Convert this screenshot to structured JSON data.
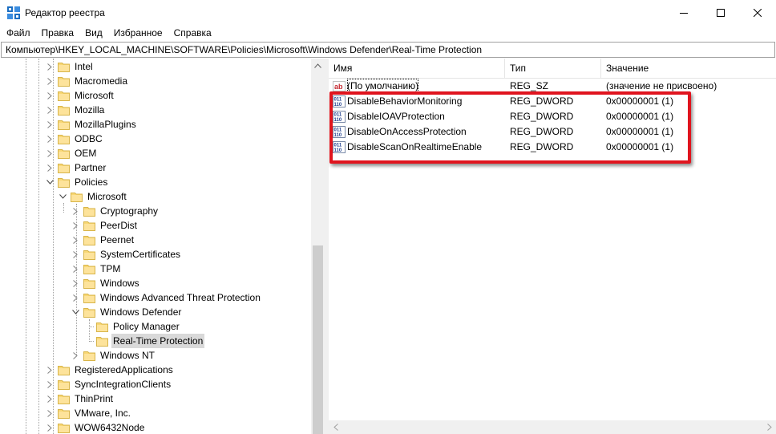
{
  "window": {
    "title": "Редактор реестра",
    "minimize_icon": "minimize-icon",
    "maximize_icon": "maximize-icon",
    "close_icon": "close-icon"
  },
  "menu": [
    "Файл",
    "Правка",
    "Вид",
    "Избранное",
    "Справка"
  ],
  "address": "Компьютер\\HKEY_LOCAL_MACHINE\\SOFTWARE\\Policies\\Microsoft\\Windows Defender\\Real-Time Protection",
  "tree": [
    {
      "label": "Intel",
      "expanded": false
    },
    {
      "label": "Macromedia",
      "expanded": false
    },
    {
      "label": "Microsoft",
      "expanded": false
    },
    {
      "label": "Mozilla",
      "expanded": false
    },
    {
      "label": "MozillaPlugins",
      "expanded": false
    },
    {
      "label": "ODBC",
      "expanded": false
    },
    {
      "label": "OEM",
      "expanded": false
    },
    {
      "label": "Partner",
      "expanded": false
    },
    {
      "label": "Policies",
      "expanded": true
    },
    {
      "label": "Microsoft",
      "expanded": true
    },
    {
      "label": "Cryptography",
      "expanded": false
    },
    {
      "label": "PeerDist",
      "expanded": false
    },
    {
      "label": "Peernet",
      "expanded": false
    },
    {
      "label": "SystemCertificates",
      "expanded": false
    },
    {
      "label": "TPM",
      "expanded": false
    },
    {
      "label": "Windows",
      "expanded": false
    },
    {
      "label": "Windows Advanced Threat Protection",
      "expanded": false
    },
    {
      "label": "Windows Defender",
      "expanded": true
    },
    {
      "label": "Policy Manager",
      "expanded": false
    },
    {
      "label": "Real-Time Protection",
      "expanded": false,
      "selected": true
    },
    {
      "label": "Windows NT",
      "expanded": false
    },
    {
      "label": "RegisteredApplications",
      "expanded": false
    },
    {
      "label": "SyncIntegrationClients",
      "expanded": false
    },
    {
      "label": "ThinPrint",
      "expanded": false
    },
    {
      "label": "VMware, Inc.",
      "expanded": false
    },
    {
      "label": "WOW6432Node",
      "expanded": false
    }
  ],
  "columns": {
    "name": "Имя",
    "type": "Тип",
    "value": "Значение"
  },
  "values": [
    {
      "name": "(По умолчанию)",
      "type": "REG_SZ",
      "data": "(значение не присвоено)",
      "icon": "string-value-icon"
    },
    {
      "name": "DisableBehaviorMonitoring",
      "type": "REG_DWORD",
      "data": "0x00000001 (1)",
      "icon": "dword-value-icon"
    },
    {
      "name": "DisableIOAVProtection",
      "type": "REG_DWORD",
      "data": "0x00000001 (1)",
      "icon": "dword-value-icon"
    },
    {
      "name": "DisableOnAccessProtection",
      "type": "REG_DWORD",
      "data": "0x00000001 (1)",
      "icon": "dword-value-icon"
    },
    {
      "name": "DisableScanOnRealtimeEnable",
      "type": "REG_DWORD",
      "data": "0x00000001 (1)",
      "icon": "dword-value-icon"
    }
  ],
  "colors": {
    "highlight": "#e0141e",
    "folder": "#f8d775",
    "selection": "#d9d9d9"
  }
}
